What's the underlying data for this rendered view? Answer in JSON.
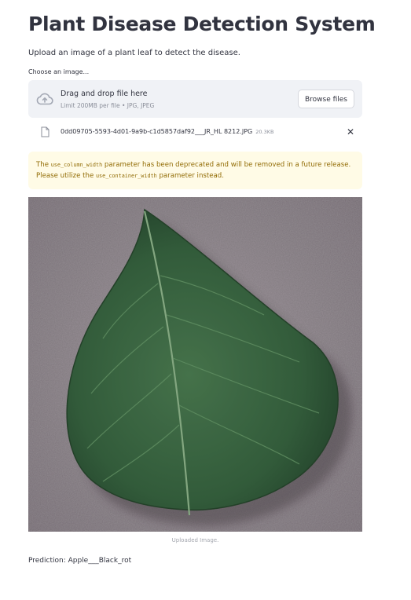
{
  "app": {
    "title": "Plant Disease Detection System",
    "description": "Upload an image of a plant leaf to detect the disease."
  },
  "uploader": {
    "label": "Choose an image...",
    "drop_title": "Drag and drop file here",
    "drop_subtitle": "Limit 200MB per file • JPG, JPEG",
    "browse_label": "Browse files",
    "cloud_icon": "cloud-upload-icon"
  },
  "uploaded_file": {
    "name": "0dd09705-5593-4d01-9a9b-c1d5857daf92___JR_HL 8212.JPG",
    "size": "20.3KB",
    "file_icon": "file-icon",
    "close_icon": "close-icon"
  },
  "warning": {
    "prefix": "The ",
    "param_old": "use_column_width",
    "middle": " parameter has been deprecated and will be removed in a future release. Please utilize the ",
    "param_new": "use_container_width",
    "suffix": " parameter instead.",
    "color": "#926c05",
    "background": "#fffbe6"
  },
  "image": {
    "caption": "Uploaded Image."
  },
  "result": {
    "prediction": "Prediction: Apple___Black_rot"
  }
}
